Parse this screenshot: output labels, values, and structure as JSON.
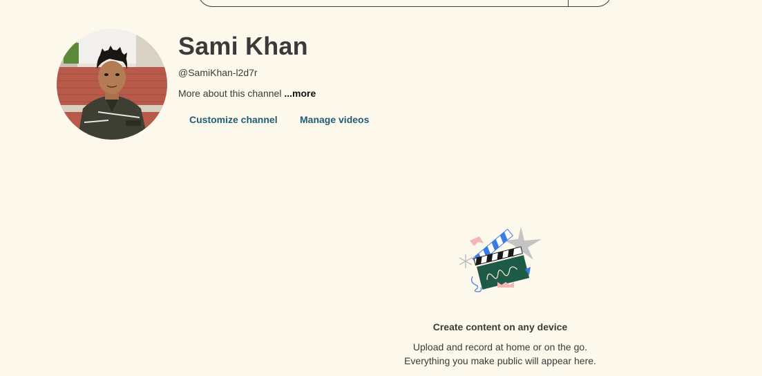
{
  "header": {
    "search_icon": "search-icon"
  },
  "channel": {
    "name": "Sami Khan",
    "handle": "@SamiKhan-l2d7r",
    "about_text": "More about this channel",
    "more_label": "...more",
    "buttons": {
      "customize": "Customize channel",
      "manage": "Manage videos"
    }
  },
  "empty_state": {
    "illustration": "clapperboard-icon",
    "title": "Create content on any device",
    "description_line1": "Upload and record at home or on the go.",
    "description_line2": "Everything you make public will appear here."
  },
  "colors": {
    "background": "#fdf8ec",
    "text": "#3a3a3a",
    "link": "#1f5c76",
    "clapper_green": "#1e5a48",
    "accent_blue": "#3b7be6",
    "accent_pink": "#f3b6b6",
    "accent_gray": "#c4c4c4"
  }
}
